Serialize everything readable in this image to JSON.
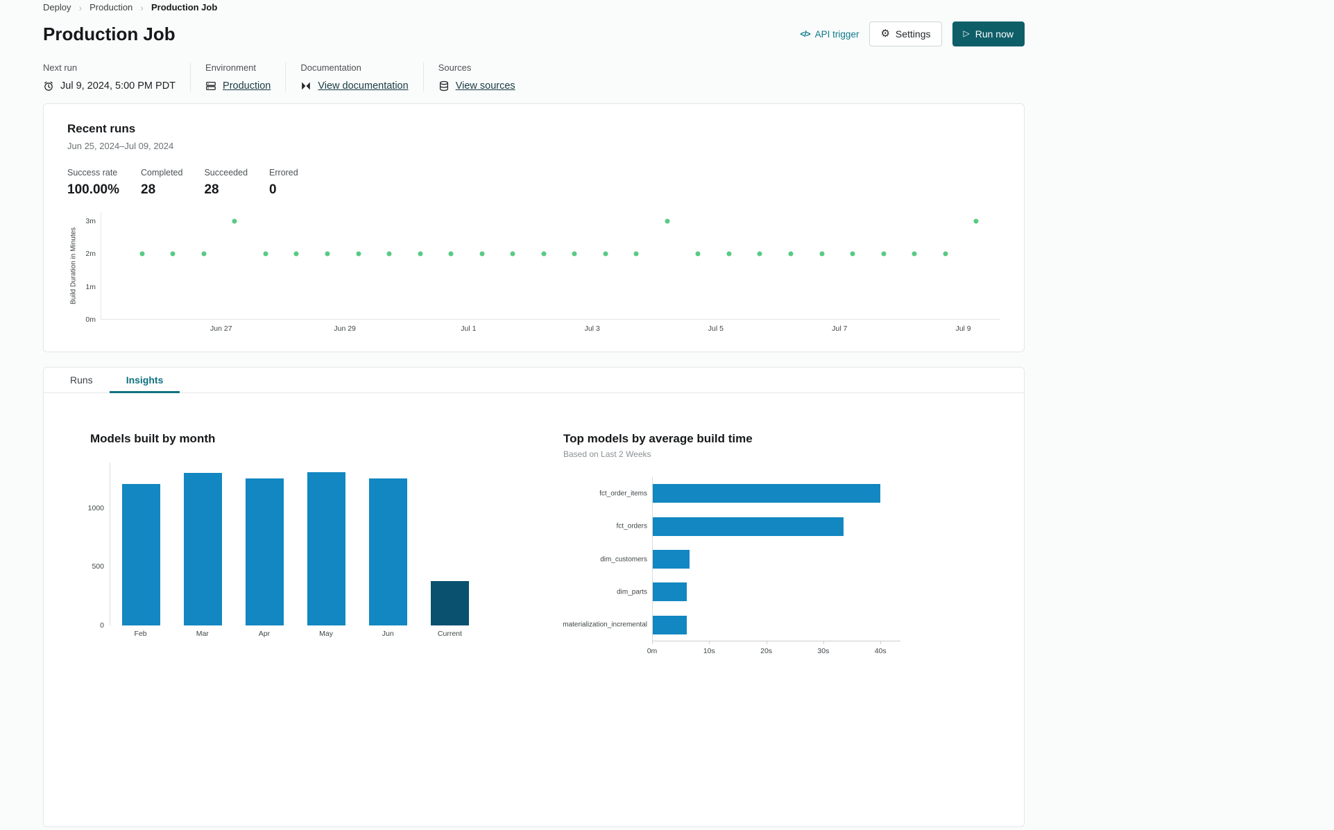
{
  "breadcrumb": {
    "items": [
      "Deploy",
      "Production",
      "Production Job"
    ]
  },
  "header": {
    "title": "Production Job",
    "api_trigger_label": "API trigger",
    "settings_label": "Settings",
    "run_now_label": "Run now"
  },
  "icons": {
    "chevron": "›",
    "code": "</>",
    "gear": "⚙",
    "play": "▷",
    "clock": "alarm-clock-icon",
    "environment": "environment-stack-icon",
    "documentation": "docs-bowtie-icon",
    "sources": "database-icon"
  },
  "info_bar": {
    "next_run": {
      "label": "Next run",
      "value": "Jul 9, 2024, 5:00 PM PDT"
    },
    "environment": {
      "label": "Environment",
      "link_text": "Production"
    },
    "documentation": {
      "label": "Documentation",
      "link_text": "View documentation"
    },
    "sources": {
      "label": "Sources",
      "link_text": "View sources"
    }
  },
  "recent_runs": {
    "title": "Recent runs",
    "date_range": "Jun 25, 2024–Jul 09, 2024",
    "stats": [
      {
        "label": "Success rate",
        "value": "100.00%"
      },
      {
        "label": "Completed",
        "value": "28"
      },
      {
        "label": "Succeeded",
        "value": "28"
      },
      {
        "label": "Errored",
        "value": "0"
      }
    ]
  },
  "tabs": [
    {
      "label": "Runs",
      "active": false
    },
    {
      "label": "Insights",
      "active": true
    }
  ],
  "colors": {
    "accent_teal": "#0E7989",
    "primary_button_teal": "#0E5E68",
    "success_green": "#58CA83",
    "chart_blue": "#1287C1",
    "chart_dark_blue": "#0A5170",
    "card_border": "#E4E6E8",
    "page_background": "#FAFBFB"
  },
  "chart_data": [
    {
      "id": "run-duration-scatter",
      "type": "scatter",
      "ylabel": "Build Duration in Minutes",
      "point_color": "#58CA83",
      "y_ticks": [
        {
          "label": "0m",
          "value": 0
        },
        {
          "label": "1m",
          "value": 1
        },
        {
          "label": "2m",
          "value": 2
        },
        {
          "label": "3m",
          "value": 3
        }
      ],
      "x_ticks": [
        {
          "label": "Jun 27",
          "day": 2
        },
        {
          "label": "Jun 29",
          "day": 4
        },
        {
          "label": "Jul 1",
          "day": 6
        },
        {
          "label": "Jul 3",
          "day": 8
        },
        {
          "label": "Jul 5",
          "day": 10
        },
        {
          "label": "Jul 7",
          "day": 12
        },
        {
          "label": "Jul 9",
          "day": 14
        }
      ],
      "x_domain": [
        0.05,
        14.6
      ],
      "y_domain": [
        0,
        3.28
      ],
      "points": {
        "days": [
          0.71,
          1.21,
          1.71,
          2.21,
          2.71,
          3.21,
          3.71,
          4.21,
          4.71,
          5.21,
          5.71,
          6.21,
          6.71,
          7.21,
          7.71,
          8.21,
          8.71,
          9.21,
          9.71,
          10.21,
          10.71,
          11.21,
          11.71,
          12.21,
          12.71,
          13.21,
          13.71,
          14.21
        ],
        "minutes": [
          2,
          2,
          2,
          3,
          2,
          2,
          2,
          2,
          2,
          2,
          2,
          2,
          2,
          2,
          2,
          2,
          2,
          3,
          2,
          2,
          2,
          2,
          2,
          2,
          2,
          2,
          2,
          3
        ]
      }
    },
    {
      "id": "models-built-by-month",
      "type": "bar",
      "title": "Models built by month",
      "categories": [
        "Feb",
        "Mar",
        "Apr",
        "May",
        "Jun",
        "Current"
      ],
      "values": [
        1205,
        1300,
        1255,
        1310,
        1255,
        380
      ],
      "y_ticks": [
        0,
        500,
        1000
      ],
      "ylim": [
        0,
        1390
      ],
      "bar_color": "#1287C1",
      "highlight_color": "#0A5170",
      "highlight_index": 5
    },
    {
      "id": "top-models-by-average-build-time",
      "type": "hbar",
      "title": "Top models by average build time",
      "subtitle": "Based on Last 2 Weeks",
      "categories": [
        "fct_order_items",
        "fct_orders",
        "dim_customers",
        "dim_parts",
        "materialization_incremental"
      ],
      "values_seconds": [
        40,
        33.5,
        6.5,
        6,
        6
      ],
      "x_ticks": [
        "0m",
        "10s",
        "20s",
        "30s",
        "40s"
      ],
      "x_tick_values": [
        0,
        10,
        20,
        30,
        40
      ],
      "xlim": [
        0,
        43.5
      ],
      "bar_color": "#1287C1"
    }
  ]
}
